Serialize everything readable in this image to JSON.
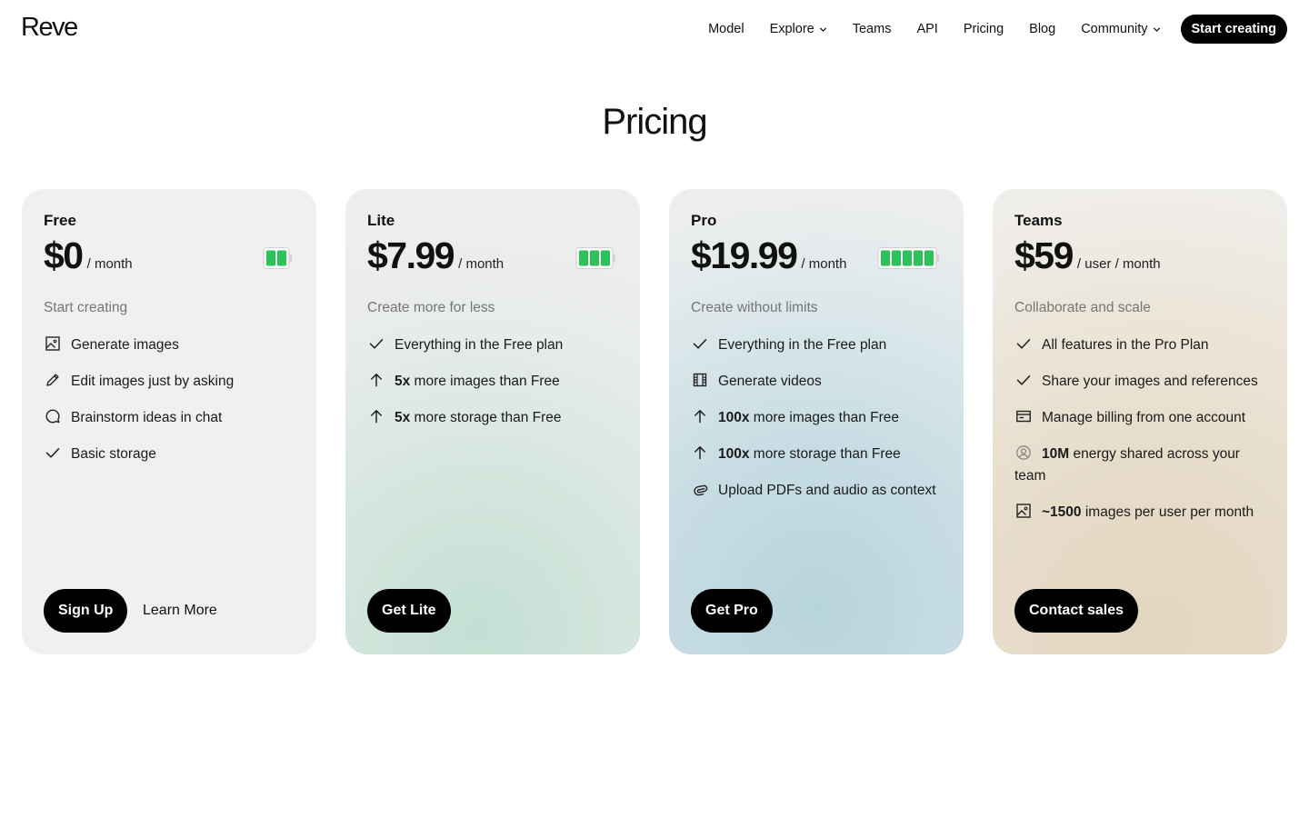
{
  "header": {
    "logo": "Reve",
    "nav": [
      {
        "label": "Model"
      },
      {
        "label": "Explore"
      },
      {
        "label": "Teams"
      },
      {
        "label": "API"
      },
      {
        "label": "Pricing"
      },
      {
        "label": "Blog"
      },
      {
        "label": "Community"
      }
    ],
    "cta_label": "Start creating"
  },
  "page_title": "Pricing",
  "plans": [
    {
      "name": "Free",
      "price": "$0",
      "period": "/ month",
      "battery_bars": 2,
      "tagline": "Start creating",
      "features": [
        {
          "icon": "image-icon",
          "bold": "",
          "text": "Generate images"
        },
        {
          "icon": "pencil-icon",
          "bold": "",
          "text": "Edit images just by asking"
        },
        {
          "icon": "chat-bubble-icon",
          "bold": "",
          "text": "Brainstorm ideas in chat"
        },
        {
          "icon": "check-icon",
          "bold": "",
          "text": "Basic storage"
        }
      ],
      "primary_button": "Sign Up",
      "secondary_link": "Learn More"
    },
    {
      "name": "Lite",
      "price": "$7.99",
      "period": "/ month",
      "battery_bars": 3,
      "tagline": "Create more for less",
      "features": [
        {
          "icon": "check-icon",
          "bold": "",
          "text": "Everything in the Free plan"
        },
        {
          "icon": "arrow-up-icon",
          "bold": "5x",
          "text": " more images than Free"
        },
        {
          "icon": "arrow-up-icon",
          "bold": "5x",
          "text": " more storage than Free"
        }
      ],
      "primary_button": "Get Lite"
    },
    {
      "name": "Pro",
      "price": "$19.99",
      "period": "/ month",
      "battery_bars": 5,
      "tagline": "Create without limits",
      "features": [
        {
          "icon": "check-icon",
          "bold": "",
          "text": "Everything in the Free plan"
        },
        {
          "icon": "film-icon",
          "bold": "",
          "text": "Generate videos"
        },
        {
          "icon": "arrow-up-icon",
          "bold": "100x",
          "text": " more images than Free"
        },
        {
          "icon": "arrow-up-icon",
          "bold": "100x",
          "text": " more storage than Free"
        },
        {
          "icon": "paperclip-icon",
          "bold": "",
          "text": "Upload PDFs and audio as context"
        }
      ],
      "primary_button": "Get Pro"
    },
    {
      "name": "Teams",
      "price": "$59",
      "period": "/ user / month",
      "battery_bars": 0,
      "tagline": "Collaborate and scale",
      "features": [
        {
          "icon": "check-icon",
          "bold": "",
          "text": "All features in the Pro Plan"
        },
        {
          "icon": "check-icon",
          "bold": "",
          "text": "Share your images and references"
        },
        {
          "icon": "credit-card-icon",
          "bold": "",
          "text": "Manage billing from one account"
        },
        {
          "icon": "user-circle-icon",
          "bold": "10M",
          "text": " energy shared across your team"
        },
        {
          "icon": "image-icon",
          "bold": "~1500",
          "text": " images per user per month"
        }
      ],
      "primary_button": "Contact sales"
    }
  ],
  "colors": {
    "battery_fill": "#2cc25a",
    "button_bg": "#000000",
    "tagline": "#767676"
  }
}
